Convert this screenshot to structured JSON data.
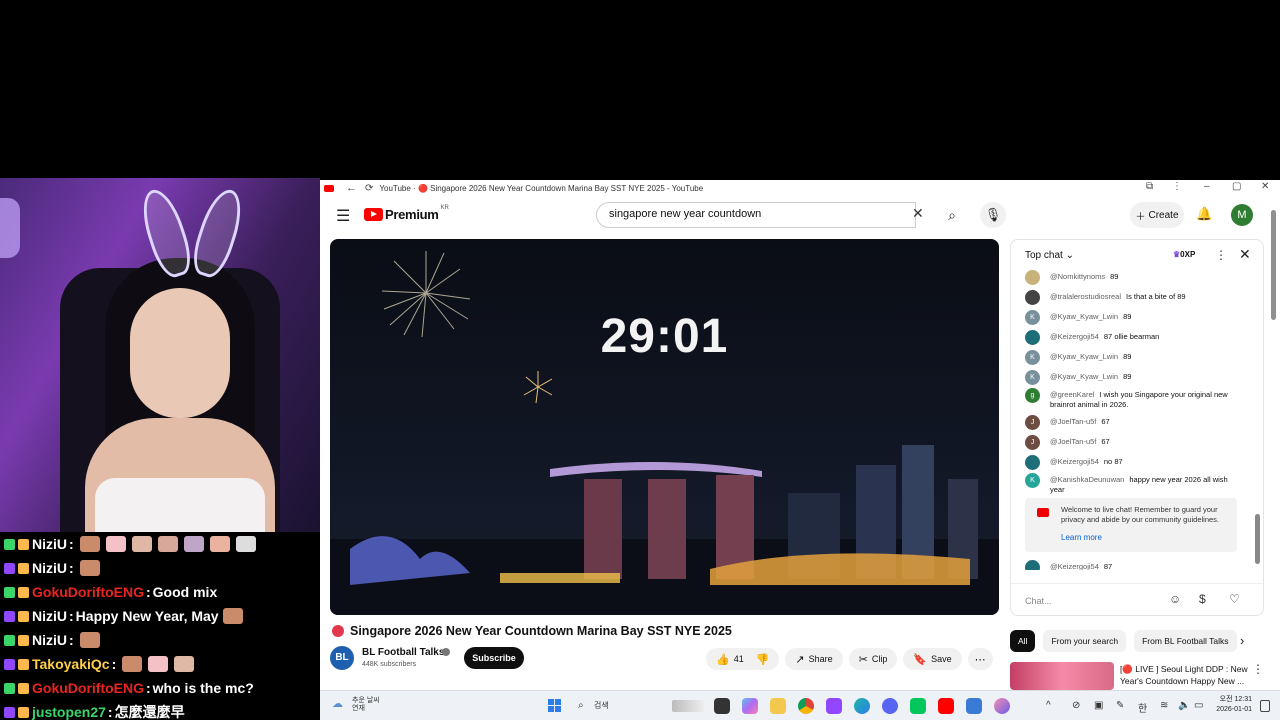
{
  "window": {
    "title": "YouTube · 🔴 Singapore 2026 New Year Countdown Marina Bay SST NYE 2025 - YouTube"
  },
  "masthead": {
    "logo_text": "Premium",
    "country": "KR",
    "search_value": "singapore new year countdown",
    "create_label": "Create",
    "avatar_letter": "M"
  },
  "player": {
    "timer": "29:01"
  },
  "video": {
    "title": "Singapore 2026 New Year Countdown Marina Bay SST NYE 2025",
    "channel_avatar": "BL",
    "channel_name": "BL Football Talks",
    "subscribers": "448K subscribers",
    "subscribe_label": "Subscribe",
    "like_count": "41",
    "share_label": "Share",
    "clip_label": "Clip",
    "save_label": "Save"
  },
  "livechat": {
    "mode": "Top chat",
    "xp": "0XP",
    "messages": [
      {
        "author": "@Nomkittynoms",
        "text": "89",
        "avatar": "",
        "color": "#c9b27a"
      },
      {
        "author": "@tralalerostudiosreal",
        "text": "Is that a bite of 89",
        "avatar": "",
        "color": "#444444"
      },
      {
        "author": "@Kyaw_Kyaw_Lwin",
        "text": "89",
        "avatar": "K",
        "color": "#78909c"
      },
      {
        "author": "@Keizergoji54",
        "text": "87 ollie bearman",
        "avatar": "",
        "color": "#1e6e7a"
      },
      {
        "author": "@Kyaw_Kyaw_Lwin",
        "text": "89",
        "avatar": "K",
        "color": "#78909c"
      },
      {
        "author": "@Kyaw_Kyaw_Lwin",
        "text": "89",
        "avatar": "K",
        "color": "#78909c"
      },
      {
        "author": "@greenKarel",
        "text": "I wish you Singapore your original new brainrot animal in 2026.",
        "avatar": "g",
        "color": "#2e7d32"
      },
      {
        "author": "@JoelTan-u5f",
        "text": "67",
        "avatar": "J",
        "color": "#6d4c41"
      },
      {
        "author": "@JoelTan-u5f",
        "text": "67",
        "avatar": "J",
        "color": "#6d4c41"
      },
      {
        "author": "@Keizergoji54",
        "text": "no 87",
        "avatar": "",
        "color": "#1e6e7a"
      },
      {
        "author": "@KanishkaDeunuwan",
        "text": "happy new year 2026 all wish year",
        "avatar": "K",
        "color": "#26a69a"
      }
    ],
    "welcome_text": "Welcome to live chat! Remember to guard your privacy and abide by our community guidelines.",
    "learn_more": "Learn more",
    "last_message": {
      "author": "@Keizergoji54",
      "text": "87",
      "avatar": "",
      "color": "#1e6e7a"
    },
    "input_placeholder": "Chat..."
  },
  "chips": [
    "All",
    "From your search",
    "From BL Football Talks"
  ],
  "recommendation": {
    "title": "[🔴 LIVE ] Seoul Light DDP : New Year's Countdown Happy New ..."
  },
  "stream_chat": [
    {
      "user": "NiziU",
      "sep": " :",
      "msg": "",
      "user_color": "#ffffff",
      "emotes": 7
    },
    {
      "user": "NiziU",
      "sep": " :",
      "msg": "",
      "user_color": "#ffffff",
      "emotes": 1
    },
    {
      "user": "GokuDoriftoENG",
      "sep": " :",
      "msg": " Good mix",
      "user_color": "#e8261f",
      "emotes": 0
    },
    {
      "user": "NiziU",
      "sep": " :",
      "msg": " Happy New Year, May",
      "user_color": "#ffffff",
      "emotes": 1
    },
    {
      "user": "NiziU",
      "sep": " :",
      "msg": "",
      "user_color": "#ffffff",
      "emotes": 1
    },
    {
      "user": "TakoyakiQc",
      "sep": " :",
      "msg": "",
      "user_color": "#ffcf4a",
      "emotes": 3
    },
    {
      "user": "GokuDoriftoENG",
      "sep": " :",
      "msg": " who is the mc?",
      "user_color": "#e8261f",
      "emotes": 0
    },
    {
      "user": "justopen27",
      "sep": " :",
      "msg": " 怎麼還麼早",
      "user_color": "#3bd66a",
      "emotes": 0
    }
  ],
  "taskbar": {
    "weather_line1": "추운 날씨",
    "weather_line2": "연재",
    "search_label": "검색",
    "time": "오전 12:31",
    "date": "2026-01-01",
    "lang": "한"
  },
  "colors": {
    "youtube_red": "#ff0000",
    "live_red": "#e2384d",
    "link_blue": "#065fd4"
  }
}
